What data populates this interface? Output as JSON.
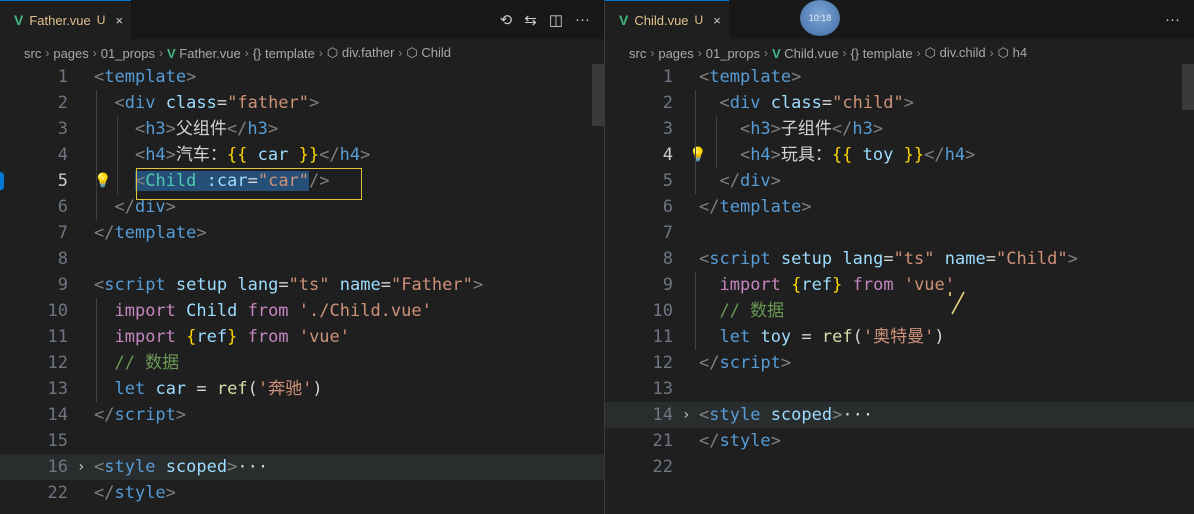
{
  "left": {
    "tab": {
      "title": "Father.vue",
      "badge": "U",
      "close": "×"
    },
    "actions": [
      "⟲",
      "⇆",
      "◫",
      "···"
    ],
    "breadcrumb": [
      {
        "text": "src"
      },
      {
        "text": "pages"
      },
      {
        "text": "01_props"
      },
      {
        "icon": "V",
        "text": "Father.vue"
      },
      {
        "icon": "{}",
        "text": "template"
      },
      {
        "icon": "⬡",
        "text": "div.father"
      },
      {
        "icon": "⬡",
        "text": "Child"
      }
    ],
    "lines": [
      {
        "n": "1",
        "tokens": [
          [
            "t",
            "<"
          ],
          [
            "tn",
            "template"
          ],
          [
            "t",
            ">"
          ]
        ]
      },
      {
        "n": "2",
        "tokens": [
          [
            "t",
            "  <"
          ],
          [
            "tn",
            "div"
          ],
          [
            "d",
            " "
          ],
          [
            "at",
            "class"
          ],
          [
            "d",
            "="
          ],
          [
            "s",
            "\"father\""
          ],
          [
            "t",
            ">"
          ]
        ]
      },
      {
        "n": "3",
        "tokens": [
          [
            "t",
            "    <"
          ],
          [
            "tn",
            "h3"
          ],
          [
            "t",
            ">"
          ],
          [
            "d",
            "父组件"
          ],
          [
            "t",
            "</"
          ],
          [
            "tn",
            "h3"
          ],
          [
            "t",
            ">"
          ]
        ]
      },
      {
        "n": "4",
        "tokens": [
          [
            "t",
            "    <"
          ],
          [
            "tn",
            "h4"
          ],
          [
            "t",
            ">"
          ],
          [
            "d",
            "汽车："
          ],
          [
            "br",
            "{{"
          ],
          [
            "d",
            " "
          ],
          [
            "var",
            "car"
          ],
          [
            "d",
            " "
          ],
          [
            "br",
            "}}"
          ],
          [
            "t",
            "</"
          ],
          [
            "tn",
            "h4"
          ],
          [
            "t",
            ">"
          ]
        ]
      },
      {
        "n": "5",
        "tokens": [
          [
            "d",
            "    "
          ],
          [
            "t sel",
            "<"
          ],
          [
            "cls sel",
            "Child"
          ],
          [
            "d sel",
            " "
          ],
          [
            "at sel",
            ":car"
          ],
          [
            "d sel",
            "="
          ],
          [
            "s sel",
            "\"car\""
          ],
          [
            "t",
            "/>"
          ]
        ]
      },
      {
        "n": "6",
        "tokens": [
          [
            "t",
            "  </"
          ],
          [
            "tn",
            "div"
          ],
          [
            "t",
            ">"
          ]
        ]
      },
      {
        "n": "7",
        "tokens": [
          [
            "t",
            "</"
          ],
          [
            "tn",
            "template"
          ],
          [
            "t",
            ">"
          ]
        ]
      },
      {
        "n": "8",
        "tokens": []
      },
      {
        "n": "9",
        "tokens": [
          [
            "t",
            "<"
          ],
          [
            "tn",
            "script"
          ],
          [
            "d",
            " "
          ],
          [
            "at",
            "setup"
          ],
          [
            "d",
            " "
          ],
          [
            "at",
            "lang"
          ],
          [
            "d",
            "="
          ],
          [
            "s",
            "\"ts\""
          ],
          [
            "d",
            " "
          ],
          [
            "at",
            "name"
          ],
          [
            "d",
            "="
          ],
          [
            "s",
            "\"Father\""
          ],
          [
            "t",
            ">"
          ]
        ]
      },
      {
        "n": "10",
        "tokens": [
          [
            "d",
            "  "
          ],
          [
            "kw",
            "import"
          ],
          [
            "d",
            " "
          ],
          [
            "var",
            "Child"
          ],
          [
            "d",
            " "
          ],
          [
            "kw",
            "from"
          ],
          [
            "d",
            " "
          ],
          [
            "s",
            "'./Child.vue'"
          ]
        ]
      },
      {
        "n": "11",
        "tokens": [
          [
            "d",
            "  "
          ],
          [
            "kw",
            "import"
          ],
          [
            "d",
            " "
          ],
          [
            "br",
            "{"
          ],
          [
            "var",
            "ref"
          ],
          [
            "br",
            "}"
          ],
          [
            "d",
            " "
          ],
          [
            "kw",
            "from"
          ],
          [
            "d",
            " "
          ],
          [
            "s",
            "'vue'"
          ]
        ]
      },
      {
        "n": "12",
        "tokens": [
          [
            "cm",
            "  // 数据"
          ]
        ]
      },
      {
        "n": "13",
        "tokens": [
          [
            "d",
            "  "
          ],
          [
            "tn",
            "let"
          ],
          [
            "d",
            " "
          ],
          [
            "var",
            "car"
          ],
          [
            "d",
            " = "
          ],
          [
            "fn",
            "ref"
          ],
          [
            "d",
            "("
          ],
          [
            "s",
            "'奔驰'"
          ],
          [
            "d",
            ")"
          ]
        ]
      },
      {
        "n": "14",
        "tokens": [
          [
            "t",
            "</"
          ],
          [
            "tn",
            "script"
          ],
          [
            "t",
            ">"
          ]
        ]
      },
      {
        "n": "15",
        "tokens": []
      },
      {
        "n": "16",
        "fold": true,
        "tokens": [
          [
            "t",
            "<"
          ],
          [
            "tn",
            "style"
          ],
          [
            "d",
            " "
          ],
          [
            "at",
            "scoped"
          ],
          [
            "t",
            ">"
          ],
          [
            "d",
            "···"
          ]
        ]
      },
      {
        "n": "22",
        "tokens": [
          [
            "t",
            "</"
          ],
          [
            "tn",
            "style"
          ],
          [
            "t",
            ">"
          ]
        ]
      }
    ]
  },
  "right": {
    "tab": {
      "title": "Child.vue",
      "badge": "U",
      "close": "×"
    },
    "actions": [
      "···"
    ],
    "avatar_text": "10:18",
    "breadcrumb": [
      {
        "text": "src"
      },
      {
        "text": "pages"
      },
      {
        "text": "01_props"
      },
      {
        "icon": "V",
        "text": "Child.vue"
      },
      {
        "icon": "{}",
        "text": "template"
      },
      {
        "icon": "⬡",
        "text": "div.child"
      },
      {
        "icon": "⬡",
        "text": "h4"
      }
    ],
    "lines": [
      {
        "n": "1",
        "tokens": [
          [
            "t",
            "<"
          ],
          [
            "tn",
            "template"
          ],
          [
            "t",
            ">"
          ]
        ]
      },
      {
        "n": "2",
        "tokens": [
          [
            "t",
            "  <"
          ],
          [
            "tn",
            "div"
          ],
          [
            "d",
            " "
          ],
          [
            "at",
            "class"
          ],
          [
            "d",
            "="
          ],
          [
            "s",
            "\"child\""
          ],
          [
            "t",
            ">"
          ]
        ]
      },
      {
        "n": "3",
        "tokens": [
          [
            "t",
            "    <"
          ],
          [
            "tn",
            "h3"
          ],
          [
            "t",
            ">"
          ],
          [
            "d",
            "子组件"
          ],
          [
            "t",
            "</"
          ],
          [
            "tn",
            "h3"
          ],
          [
            "t",
            ">"
          ]
        ]
      },
      {
        "n": "4",
        "tokens": [
          [
            "t",
            "    <"
          ],
          [
            "tn",
            "h4"
          ],
          [
            "t",
            ">"
          ],
          [
            "d",
            "玩具："
          ],
          [
            "br",
            "{{"
          ],
          [
            "d",
            " "
          ],
          [
            "var",
            "toy"
          ],
          [
            "d",
            " "
          ],
          [
            "br",
            "}}"
          ],
          [
            "t",
            "</"
          ],
          [
            "tn",
            "h4"
          ],
          [
            "t",
            ">"
          ]
        ]
      },
      {
        "n": "5",
        "tokens": [
          [
            "t",
            "  </"
          ],
          [
            "tn",
            "div"
          ],
          [
            "t",
            ">"
          ]
        ]
      },
      {
        "n": "6",
        "tokens": [
          [
            "t",
            "</"
          ],
          [
            "tn",
            "template"
          ],
          [
            "t",
            ">"
          ]
        ]
      },
      {
        "n": "7",
        "tokens": []
      },
      {
        "n": "8",
        "tokens": [
          [
            "t",
            "<"
          ],
          [
            "tn",
            "script"
          ],
          [
            "d",
            " "
          ],
          [
            "at",
            "setup"
          ],
          [
            "d",
            " "
          ],
          [
            "at",
            "lang"
          ],
          [
            "d",
            "="
          ],
          [
            "s",
            "\"ts\""
          ],
          [
            "d",
            " "
          ],
          [
            "at",
            "name"
          ],
          [
            "d",
            "="
          ],
          [
            "s",
            "\"Child\""
          ],
          [
            "t",
            ">"
          ]
        ]
      },
      {
        "n": "9",
        "tokens": [
          [
            "d",
            "  "
          ],
          [
            "kw",
            "import"
          ],
          [
            "d",
            " "
          ],
          [
            "br",
            "{"
          ],
          [
            "var",
            "ref"
          ],
          [
            "br",
            "}"
          ],
          [
            "d",
            " "
          ],
          [
            "kw",
            "from"
          ],
          [
            "d",
            " "
          ],
          [
            "s",
            "'vue'"
          ]
        ]
      },
      {
        "n": "10",
        "tokens": [
          [
            "cm",
            "  // 数据"
          ]
        ]
      },
      {
        "n": "11",
        "tokens": [
          [
            "d",
            "  "
          ],
          [
            "tn",
            "let"
          ],
          [
            "d",
            " "
          ],
          [
            "var",
            "toy"
          ],
          [
            "d",
            " = "
          ],
          [
            "fn",
            "ref"
          ],
          [
            "d",
            "("
          ],
          [
            "s",
            "'奥特曼'"
          ],
          [
            "d",
            ")"
          ]
        ]
      },
      {
        "n": "12",
        "tokens": [
          [
            "t",
            "</"
          ],
          [
            "tn",
            "script"
          ],
          [
            "t",
            ">"
          ]
        ]
      },
      {
        "n": "13",
        "tokens": []
      },
      {
        "n": "14",
        "fold": true,
        "tokens": [
          [
            "t",
            "<"
          ],
          [
            "tn",
            "style"
          ],
          [
            "d",
            " "
          ],
          [
            "at",
            "scoped"
          ],
          [
            "t",
            ">"
          ],
          [
            "d",
            "···"
          ]
        ]
      },
      {
        "n": "21",
        "tokens": [
          [
            "t",
            "</"
          ],
          [
            "tn",
            "style"
          ],
          [
            "t",
            ">"
          ]
        ]
      },
      {
        "n": "22",
        "tokens": []
      }
    ]
  }
}
